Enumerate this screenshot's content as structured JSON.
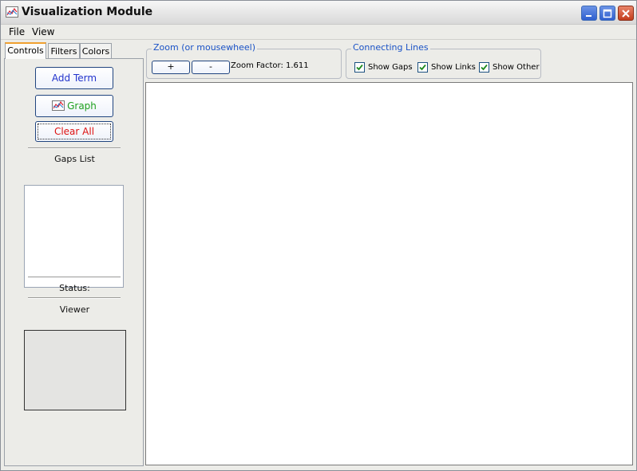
{
  "window": {
    "title": "Visualization Module"
  },
  "menu": {
    "items": [
      "File",
      "View"
    ]
  },
  "tabs": [
    "Controls",
    "Filters",
    "Colors"
  ],
  "controls": {
    "add_term": "Add Term",
    "graph": "Graph",
    "clear_all": "Clear All",
    "gaps_list": "Gaps List",
    "status": "Status:",
    "viewer": "Viewer"
  },
  "zoom": {
    "title": "Zoom (or mousewheel)",
    "plus": "+",
    "minus": "-",
    "factor": "Zoom Factor: 1.611"
  },
  "connecting_lines": {
    "title": "Connecting Lines",
    "options": [
      {
        "label": "Show Gaps",
        "checked": true
      },
      {
        "label": "Show Links",
        "checked": true
      },
      {
        "label": "Show Other",
        "checked": true
      }
    ]
  },
  "colors": {
    "add_term": "#2233cc",
    "graph": "#1fa11f",
    "clear_all": "#dd1111",
    "group_title": "#1a52c6",
    "check": "#1e8a1e"
  }
}
